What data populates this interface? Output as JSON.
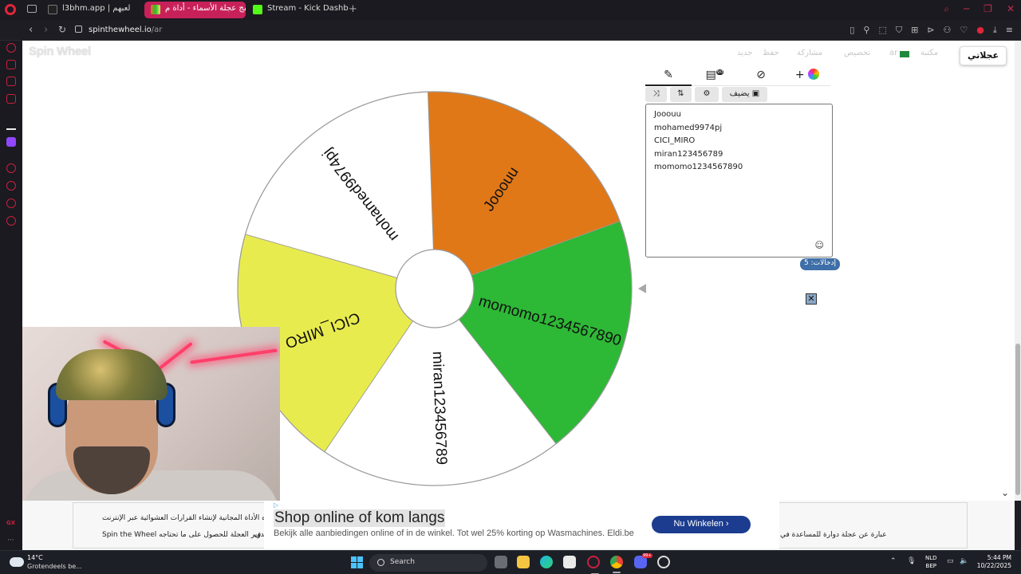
{
  "browser": {
    "tabs": [
      {
        "title": "l3bhm.app | لعبهم",
        "active": false
      },
      {
        "title": "برنامج عجلة الأسماء - أداة م...",
        "active": true
      },
      {
        "title": "Stream - Kick Dashboard",
        "active": false
      }
    ],
    "new_tab": "+",
    "address": {
      "domain": "spinthewheel.io",
      "path": "/ar"
    }
  },
  "site": {
    "logo": "Spin Wheel",
    "nav": {
      "new": "جديد",
      "save": "حفظ",
      "share": "مشاركة",
      "customize": "تخصيص",
      "language": "ar",
      "gallery": "مكتبة",
      "my_wheels": "عجلاتي"
    }
  },
  "wheel": {
    "segments": [
      {
        "name": "Jooouu",
        "color": "#e07818"
      },
      {
        "name": "momomo1234567890",
        "color": "#2db836"
      },
      {
        "name": "miran123456789",
        "color": "#ffffff"
      },
      {
        "name": "CICI_MIRO",
        "color": "#e8eb4e"
      },
      {
        "name": "mohamed9974pj",
        "color": "#ffffff"
      }
    ],
    "pointer_color": "#a8a8a8"
  },
  "editor": {
    "tabs": [
      "edit",
      "results",
      "hide",
      "colors"
    ],
    "results_badge": "90",
    "tools": {
      "shuffle": "shuffle",
      "sort": "sort",
      "settings": "settings",
      "add_image": "يضيف"
    },
    "entries": [
      "Jooouu",
      "mohamed9974pj",
      "CICI_MIRO",
      "miran123456789",
      "momomo1234567890"
    ],
    "count_label": "إدخالات: 5"
  },
  "ad": {
    "adchoice": "▷",
    "title": "Shop online of kom langs",
    "subtitle": "Bekijk alle aanbiedingen online of in de winkel. Tot wel 25% korting op Wasmachines. Eldi.be",
    "button": "Nu Winkelen",
    "bg_text_1": "ه الأداة المجانية لإنشاء القرارات العشوائية عبر الإنترنت",
    "bg_text_2": "Spin the Wheel تدوير العجلة للحصول على ما تحتاجه",
    "bg_text_3": "عبارة عن عجلة دوارة للمساعدة في",
    "bg_text_left": "ف"
  },
  "taskbar": {
    "temp": "14°C",
    "weather": "Grotendeels be...",
    "search": "Search",
    "lang_line1": "NLD",
    "lang_line2": "BEP",
    "time": "5:44 PM",
    "date": "10/22/2025",
    "discord_badge": "99+"
  }
}
